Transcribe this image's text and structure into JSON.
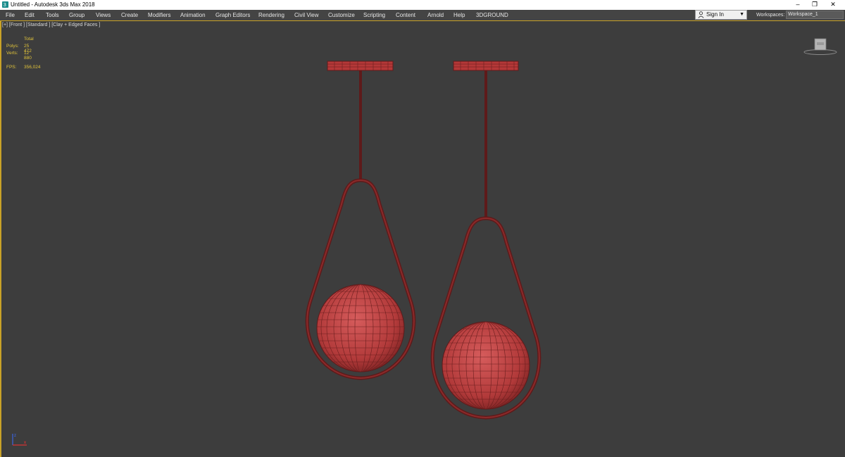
{
  "window": {
    "title": "Untitled - Autodesk 3ds Max 2018",
    "controls": {
      "minimize": "–",
      "restore": "❐",
      "close": "✕"
    }
  },
  "menu": {
    "items": [
      "File",
      "Edit",
      "Tools",
      "Group",
      "Views",
      "Create",
      "Modifiers",
      "Animation",
      "Graph Editors",
      "Rendering",
      "Civil View",
      "Customize",
      "Scripting",
      "Content",
      "Arnold",
      "Help",
      "3DGROUND"
    ]
  },
  "signin": {
    "label": "Sign In"
  },
  "workspaces": {
    "label": "Workspaces:",
    "selected": "Workspace_1"
  },
  "viewport": {
    "label": "[+] [Front ] [Standard ] [Clay + Edged Faces ]",
    "stats": {
      "header": "Total",
      "polys_label": "Polys:",
      "polys_value": "25 472",
      "verts_label": "Verts:",
      "verts_value": "12 880",
      "fps_label": "FPS:",
      "fps_value": "356,024"
    }
  },
  "colors": {
    "accent": "#c9a227",
    "viewport_bg": "#3d3d3d",
    "model_red": "#b83a3a",
    "model_dark": "#5e1a1a"
  },
  "icons": {
    "app": "3ds-max-icon",
    "person": "person-icon",
    "viewcube": "viewcube-icon",
    "axis": "axis-tripod-icon"
  }
}
